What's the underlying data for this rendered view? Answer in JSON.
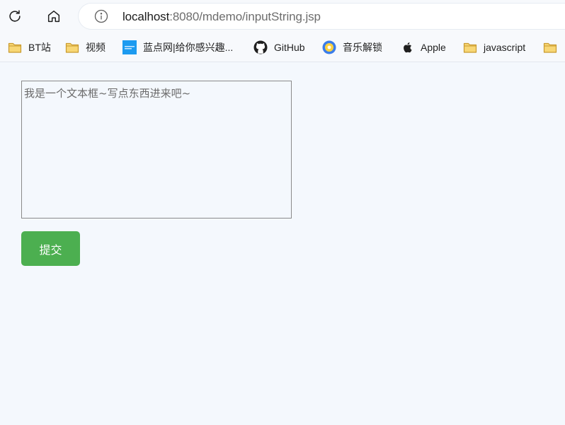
{
  "browser": {
    "address": {
      "host": "localhost",
      "path": ":8080/mdemo/inputString.jsp",
      "info_icon": "info-icon"
    },
    "reload_icon": "reload-icon",
    "home_icon": "home-icon"
  },
  "bookmarks": [
    {
      "label": "BT站",
      "icon": "folder-icon"
    },
    {
      "label": "视频",
      "icon": "folder-icon"
    },
    {
      "label": "蓝点网|给你感兴趣...",
      "icon": "site-favicon"
    },
    {
      "label": "GitHub",
      "icon": "github-icon"
    },
    {
      "label": "音乐解锁",
      "icon": "music-unlock-icon"
    },
    {
      "label": "Apple",
      "icon": "apple-icon"
    },
    {
      "label": "javascript",
      "icon": "folder-icon"
    },
    {
      "label": "",
      "icon": "folder-icon"
    }
  ],
  "form": {
    "textarea_placeholder": "我是一个文本框~写点东西进来吧~",
    "textarea_value": "",
    "submit_label": "提交"
  },
  "colors": {
    "submit_bg": "#4caf50",
    "page_bg": "#f4f8fd",
    "folder_fill": "#f8d775",
    "folder_stroke": "#c99a2e"
  }
}
